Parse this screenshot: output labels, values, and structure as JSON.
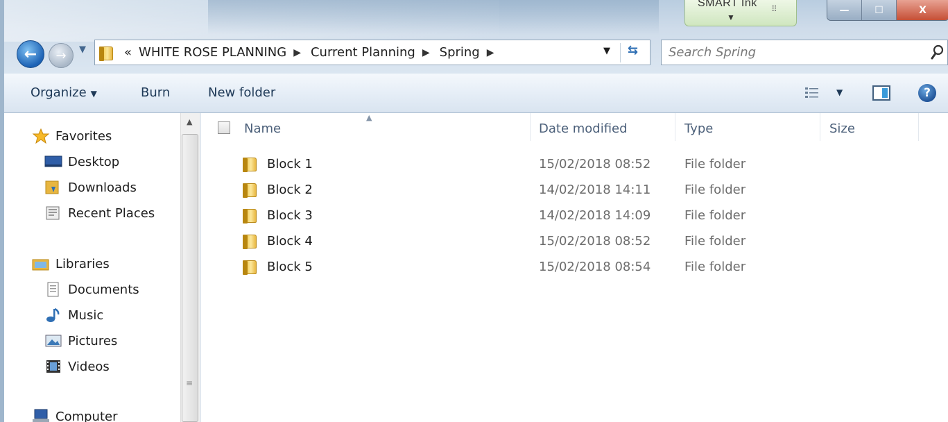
{
  "window": {
    "smart_ink_label": "SMART Ink",
    "controls": {
      "minimize": "—",
      "maximize": "☐",
      "close": "X"
    }
  },
  "navigation": {
    "back_glyph": "←",
    "forward_glyph": "→",
    "address": {
      "lead": "«",
      "crumbs": [
        "WHITE ROSE PLANNING",
        "Current Planning",
        "Spring"
      ]
    },
    "search_placeholder": "Search Spring"
  },
  "toolbar": {
    "organize": "Organize",
    "burn": "Burn",
    "new_folder": "New folder",
    "help_glyph": "?"
  },
  "nav_pane": {
    "favorites": "Favorites",
    "desktop": "Desktop",
    "downloads": "Downloads",
    "recent_places": "Recent Places",
    "libraries": "Libraries",
    "documents": "Documents",
    "music": "Music",
    "pictures": "Pictures",
    "videos": "Videos",
    "computer": "Computer"
  },
  "file_list": {
    "columns": {
      "name": "Name",
      "date_modified": "Date modified",
      "type": "Type",
      "size": "Size"
    },
    "rows": [
      {
        "name": "Block 1",
        "date": "15/02/2018 08:52",
        "type": "File folder"
      },
      {
        "name": "Block 2",
        "date": "14/02/2018 14:11",
        "type": "File folder"
      },
      {
        "name": "Block 3",
        "date": "14/02/2018 14:09",
        "type": "File folder"
      },
      {
        "name": "Block 4",
        "date": "15/02/2018 08:52",
        "type": "File folder"
      },
      {
        "name": "Block 5",
        "date": "15/02/2018 08:54",
        "type": "File folder"
      }
    ]
  },
  "colors": {
    "accent": "#1c62b5",
    "folder": "#f6d66b",
    "toolbar_text": "#1e3957",
    "secondary_text": "#6d6d6d"
  }
}
